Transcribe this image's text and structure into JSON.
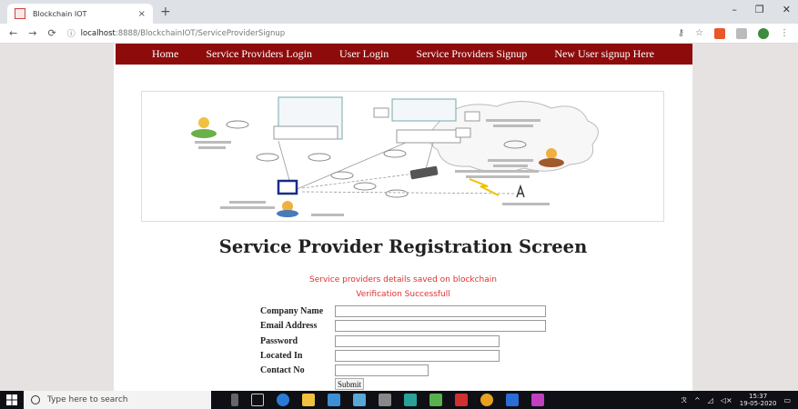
{
  "browser": {
    "tab_title": "Blockchain IOT",
    "tab_close": "×",
    "new_tab": "+",
    "window_controls": [
      "–",
      "❐",
      "✕"
    ],
    "url_host": "localhost",
    "url_rest": ":8888/BlockchainIOT/ServiceProviderSignup"
  },
  "nav": {
    "items": [
      "Home",
      "Service Providers Login",
      "User Login",
      "Service Providers Signup",
      "New User signup Here"
    ]
  },
  "main": {
    "heading": "Service Provider Registration Screen",
    "message_1": "Service providers details saved on blockchain",
    "message_2": "Verification Successfull"
  },
  "form": {
    "fields": [
      {
        "label": "Company Name",
        "value": ""
      },
      {
        "label": "Email Address",
        "value": ""
      },
      {
        "label": "Password",
        "value": ""
      },
      {
        "label": "Located In",
        "value": ""
      },
      {
        "label": "Contact No",
        "value": ""
      }
    ],
    "submit_label": "Submit"
  },
  "taskbar": {
    "search_placeholder": "Type here to search",
    "time": "15:37",
    "date": "19-05-2020"
  },
  "colors": {
    "navbar": "#8e0b0b",
    "message": "#e03030"
  }
}
